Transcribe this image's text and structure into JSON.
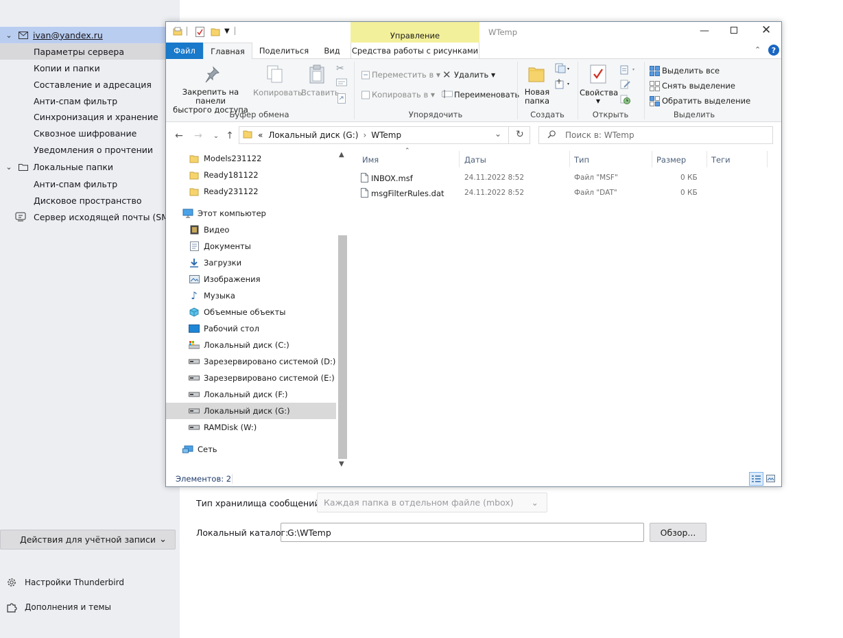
{
  "thunderbird": {
    "account": "ivan@yandex.ru",
    "account_items": [
      "Параметры сервера",
      "Копии и папки",
      "Составление и адресация",
      "Анти-спам фильтр",
      "Синхронизация и хранение",
      "Сквозное шифрование",
      "Уведомления о прочтении"
    ],
    "local_folders": "Локальные папки",
    "local_items": [
      "Анти-спам фильтр",
      "Дисковое пространство"
    ],
    "smtp": "Сервер исходящей почты (SMTP)",
    "actions_label": "Действия для учётной записи",
    "settings_label": "Настройки Thunderbird",
    "addons_label": "Дополнения и темы",
    "store_type_label": "Тип хранилища сообщений:",
    "store_type_value": "Каждая папка в отдельном файле (mbox)",
    "local_dir_label": "Локальный каталог:",
    "local_dir_value": "G:\\WTemp",
    "browse_label": "Обзор..."
  },
  "explorer": {
    "window_title": "WTemp",
    "context_tab": "Управление",
    "context_sub": "Средства работы с рисунками",
    "tabs": [
      "Файл",
      "Главная",
      "Поделиться",
      "Вид"
    ],
    "ribbon": {
      "pin_line1": "Закрепить на панели",
      "pin_line2": "быстрого доступа",
      "copy": "Копировать",
      "paste": "Вставить",
      "clipboard_group": "Буфер обмена",
      "move_to": "Переместить в",
      "copy_to": "Копировать в",
      "delete": "Удалить",
      "rename": "Переименовать",
      "organize_group": "Упорядочить",
      "new_folder_line1": "Новая",
      "new_folder_line2": "папка",
      "create_group": "Создать",
      "properties": "Свойства",
      "open_group": "Открыть",
      "select_all": "Выделить все",
      "select_none": "Снять выделение",
      "invert_selection": "Обратить выделение",
      "select_group": "Выделить"
    },
    "address": {
      "prefix": "«",
      "drive": "Локальный диск (G:)",
      "sep": "›",
      "folder": "WTemp"
    },
    "search_placeholder": "Поиск в: WTemp",
    "tree": [
      {
        "label": "Models231122",
        "icon": "folder"
      },
      {
        "label": "Ready181122",
        "icon": "folder"
      },
      {
        "label": "Ready231122",
        "icon": "folder"
      },
      {
        "label": "Этот компьютер",
        "icon": "computer"
      },
      {
        "label": "Видео",
        "icon": "video"
      },
      {
        "label": "Документы",
        "icon": "documents"
      },
      {
        "label": "Загрузки",
        "icon": "downloads"
      },
      {
        "label": "Изображения",
        "icon": "pictures"
      },
      {
        "label": "Музыка",
        "icon": "music"
      },
      {
        "label": "Объемные объекты",
        "icon": "3d"
      },
      {
        "label": "Рабочий стол",
        "icon": "desktop"
      },
      {
        "label": "Локальный диск (C:)",
        "icon": "drive-c"
      },
      {
        "label": "Зарезервировано системой (D:)",
        "icon": "drive"
      },
      {
        "label": "Зарезервировано системой (E:)",
        "icon": "drive"
      },
      {
        "label": "Локальный диск (F:)",
        "icon": "drive"
      },
      {
        "label": "Локальный диск (G:)",
        "icon": "drive"
      },
      {
        "label": "RAMDisk (W:)",
        "icon": "drive"
      },
      {
        "label": "Сеть",
        "icon": "network"
      }
    ],
    "columns": [
      "Имя",
      "Даты",
      "Тип",
      "Размер",
      "Теги"
    ],
    "files": [
      {
        "name": "INBOX.msf",
        "date": "24.11.2022 8:52",
        "type": "Файл \"MSF\"",
        "size": "0 КБ"
      },
      {
        "name": "msgFilterRules.dat",
        "date": "24.11.2022 8:52",
        "type": "Файл \"DAT\"",
        "size": "0 КБ"
      }
    ],
    "status": "Элементов: 2"
  },
  "colors": {
    "accent": "#0063b1",
    "file_tab": "#1979ca",
    "context_tab": "#f3f09b",
    "account_highlight": "#b9cdf0"
  }
}
